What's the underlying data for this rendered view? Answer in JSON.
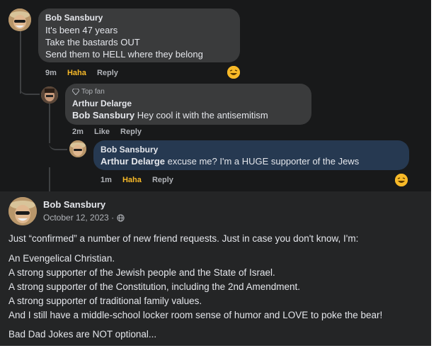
{
  "comments": [
    {
      "author": "Bob Sansbury",
      "lines": [
        "It's been 47 years",
        "Take the bastards OUT",
        "Send them to HELL where they belong"
      ],
      "time": "9m",
      "reaction": "Haha",
      "reply": "Reply",
      "reaction_icon": "laughing-emoji-icon"
    },
    {
      "badge": "Top fan",
      "author": "Arthur Delarge",
      "mention": "Bob Sansbury",
      "text": "Hey cool it with the antisemitism",
      "time": "2m",
      "reaction": "Like",
      "reply": "Reply"
    },
    {
      "author": "Bob Sansbury",
      "mention": "Arthur Delarge",
      "text": "excuse me? I'm a HUGE supporter of the Jews",
      "time": "1m",
      "reaction": "Haha",
      "reply": "Reply",
      "reaction_icon": "laughing-emoji-icon"
    }
  ],
  "post": {
    "author": "Bob Sansbury",
    "date": "October 12, 2023 ·",
    "privacy_icon": "globe-icon",
    "paragraphs": [
      "Just “confirmed” a number of new friend requests.  Just in case you don't know, I'm:",
      "An Evengelical Christian.",
      "A strong supporter of the Jewish people and the State of Israel.",
      "A strong supporter of the Constitution, including the 2nd Amendment.",
      "A strong supporter of traditional family values.",
      "And I still have a middle-school locker room sense of humor and LOVE to poke the bear!",
      "Bad Dad Jokes are NOT optional..."
    ]
  },
  "colors": {
    "dark_bg": "#18191a",
    "post_bg": "#242526",
    "bubble": "#3a3b3c",
    "reply_bubble": "#263951",
    "haha": "#f7b928"
  }
}
